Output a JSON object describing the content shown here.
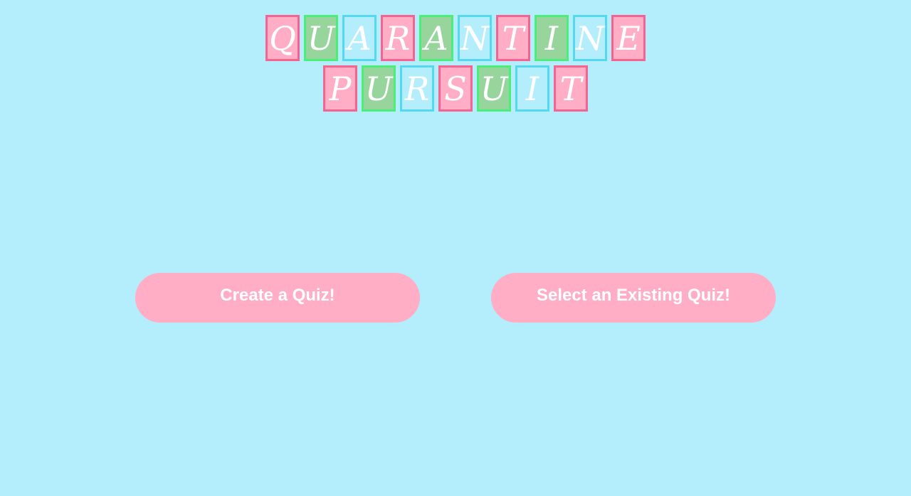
{
  "title": {
    "line1": [
      {
        "letter": "Q",
        "color": "pink"
      },
      {
        "letter": "U",
        "color": "green"
      },
      {
        "letter": "A",
        "color": "blue"
      },
      {
        "letter": "R",
        "color": "pink"
      },
      {
        "letter": "A",
        "color": "green"
      },
      {
        "letter": "N",
        "color": "blue"
      },
      {
        "letter": "T",
        "color": "pink"
      },
      {
        "letter": "I",
        "color": "green"
      },
      {
        "letter": "N",
        "color": "blue"
      },
      {
        "letter": "E",
        "color": "pink"
      }
    ],
    "line2": [
      {
        "letter": "P",
        "color": "pink"
      },
      {
        "letter": "U",
        "color": "green"
      },
      {
        "letter": "R",
        "color": "blue"
      },
      {
        "letter": "S",
        "color": "pink"
      },
      {
        "letter": "U",
        "color": "green"
      },
      {
        "letter": "I",
        "color": "blue"
      },
      {
        "letter": "T",
        "color": "pink"
      }
    ]
  },
  "buttons": {
    "create_label": "Create a Quiz!",
    "select_label": "Select an Existing Quiz!"
  },
  "colors": {
    "background": "#b4eefd",
    "pink_fill": "#ffaec5",
    "pink_border": "#f76391",
    "green_fill": "#97d59d",
    "green_border": "#4bee78",
    "blue_fill": "#b4eefd",
    "blue_border": "#54d9f1",
    "button": "#ffaec5",
    "text": "#ffffff"
  }
}
